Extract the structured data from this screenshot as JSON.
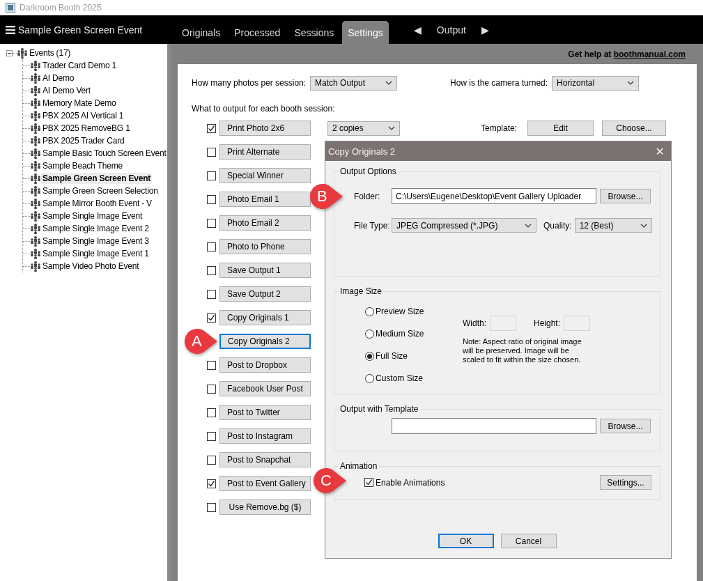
{
  "window": {
    "title": "Darkroom Booth 2025"
  },
  "header": {
    "event_name": "Sample Green Screen Event",
    "tabs": [
      {
        "label": "Originals",
        "selected": false
      },
      {
        "label": "Processed",
        "selected": false
      },
      {
        "label": "Sessions",
        "selected": false
      },
      {
        "label": "Settings",
        "selected": true
      }
    ],
    "nav": {
      "prev": "◀",
      "label": "Output",
      "next": "▶"
    }
  },
  "sidebar": {
    "root": {
      "label": "Events (17)",
      "expanded": true,
      "children": [
        {
          "label": "Trader Card Demo 1",
          "selected": false
        },
        {
          "label": "AI Demo",
          "selected": false
        },
        {
          "label": "AI Demo Vert",
          "selected": false
        },
        {
          "label": "Memory Mate Demo",
          "selected": false
        },
        {
          "label": "PBX 2025 AI Vertical 1",
          "selected": false
        },
        {
          "label": "PBX 2025 RemoveBG 1",
          "selected": false
        },
        {
          "label": "PBX 2025 Trader Card",
          "selected": false
        },
        {
          "label": "Sample Basic Touch Screen Event",
          "selected": false
        },
        {
          "label": "Sample Beach Theme",
          "selected": false
        },
        {
          "label": "Sample Green Screen Event",
          "selected": true
        },
        {
          "label": "Sample Green Screen Selection",
          "selected": false
        },
        {
          "label": "Sample Mirror Booth Event - V",
          "selected": false
        },
        {
          "label": "Sample Single Image Event",
          "selected": false
        },
        {
          "label": "Sample Single Image Event 2",
          "selected": false
        },
        {
          "label": "Sample Single Image Event 3",
          "selected": false
        },
        {
          "label": "Sample Single Image Event 1",
          "selected": false
        },
        {
          "label": "Sample Video Photo Event",
          "selected": false
        }
      ]
    }
  },
  "help": {
    "prefix": "Get help at",
    "link": "boothmanual.com"
  },
  "settings": {
    "photos_per_session": {
      "label": "How many photos per session:",
      "value": "Match Output"
    },
    "camera": {
      "label": "How is the camera turned:",
      "value": "Horizontal"
    },
    "outputs_heading": "What to output for each booth session:",
    "copies": {
      "value": "2 copies"
    },
    "template": {
      "label": "Template:",
      "edit": "Edit",
      "choose": "Choose..."
    },
    "outputs": [
      {
        "kind": "checkbox",
        "label": "Print Photo  2x6",
        "checked": true
      },
      {
        "kind": "checkbox",
        "label": "Print Alternate",
        "checked": false
      },
      {
        "kind": "checkbox",
        "label": "Special Winner",
        "checked": false
      },
      {
        "kind": "checkbox",
        "label": "Photo Email 1",
        "checked": false
      },
      {
        "kind": "checkbox",
        "label": "Photo Email 2",
        "checked": false
      },
      {
        "kind": "checkbox",
        "label": "Photo to Phone",
        "checked": false
      },
      {
        "kind": "checkbox",
        "label": "Save Output 1",
        "checked": false
      },
      {
        "kind": "checkbox",
        "label": "Save Output 2",
        "checked": false
      },
      {
        "kind": "checkbox",
        "label": "Copy Originals 1",
        "checked": true
      },
      {
        "kind": "focused",
        "label": "Copy Originals 2"
      },
      {
        "kind": "checkbox",
        "label": "Post to Dropbox",
        "checked": false
      },
      {
        "kind": "checkbox",
        "label": "Facebook User Post",
        "checked": false
      },
      {
        "kind": "checkbox",
        "label": "Post to Twitter",
        "checked": false
      },
      {
        "kind": "checkbox",
        "label": "Post to Instagram",
        "checked": false
      },
      {
        "kind": "checkbox",
        "label": "Post to Snapchat",
        "checked": false
      },
      {
        "kind": "checkbox",
        "label": "Post to Event Gallery",
        "checked": true
      },
      {
        "kind": "checkbox",
        "label": "Use Remove.bg ($)",
        "checked": false
      }
    ]
  },
  "dialog": {
    "title": "Copy Originals 2",
    "close": "×",
    "output_options": {
      "legend": "Output Options",
      "folder_label": "Folder:",
      "folder_value": "C:\\Users\\Eugene\\Desktop\\Event Gallery Uploader",
      "browse": "Browse...",
      "file_type_label": "File Type:",
      "file_type_value": "JPEG Compressed (*.JPG)",
      "quality_label": "Quality:",
      "quality_value": "12 (Best)"
    },
    "image_size": {
      "legend": "Image Size",
      "options": [
        {
          "label": "Preview Size",
          "selected": false
        },
        {
          "label": "Medium Size",
          "selected": false
        },
        {
          "label": "Full Size",
          "selected": true
        },
        {
          "label": "Custom Size",
          "selected": false
        }
      ],
      "width_label": "Width:",
      "height_label": "Height:",
      "note": "Note: Aspect ratio of original image will be preserved. Image will be scaled to fit within the size chosen."
    },
    "template": {
      "legend": "Output with Template",
      "browse": "Browse..."
    },
    "animation": {
      "legend": "Animation",
      "enable_label": "Enable Animations",
      "enabled": true,
      "settings": "Settings..."
    },
    "ok": "OK",
    "cancel": "Cancel"
  },
  "callouts": [
    {
      "label": "A"
    },
    {
      "label": "B"
    },
    {
      "label": "C"
    }
  ]
}
